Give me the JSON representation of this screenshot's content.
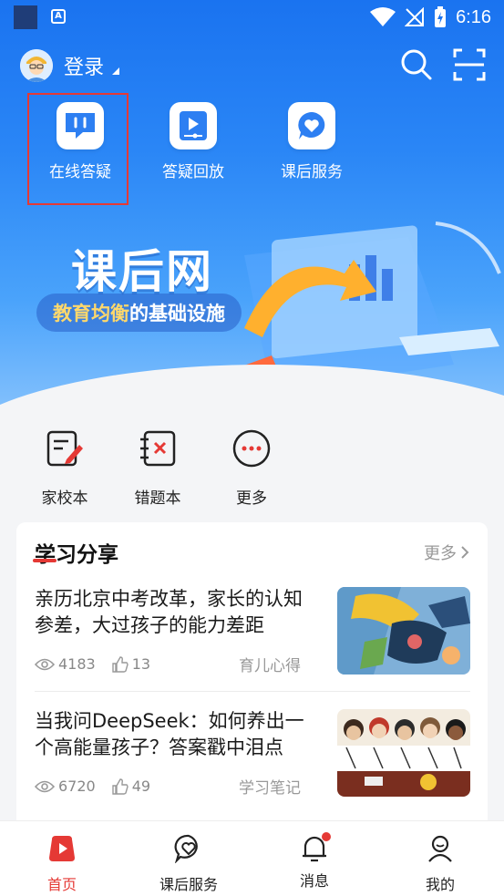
{
  "status_bar": {
    "time": "6:16"
  },
  "header": {
    "login_label": "登录"
  },
  "quick_actions": [
    {
      "label": "在线答疑",
      "icon": "chat-bubble-icon"
    },
    {
      "label": "答疑回放",
      "icon": "video-playback-icon"
    },
    {
      "label": "课后服务",
      "icon": "heart-bubble-icon"
    }
  ],
  "banner": {
    "title": "课后网",
    "subtitle_highlight": "教育均衡",
    "subtitle_rest": "的基础设施"
  },
  "tools": [
    {
      "label": "家校本",
      "icon": "notebook-edit-icon"
    },
    {
      "label": "错题本",
      "icon": "wrong-question-icon"
    },
    {
      "label": "更多",
      "icon": "more-dots-icon"
    }
  ],
  "study_share": {
    "title": "学习分享",
    "more_label": "更多",
    "articles": [
      {
        "title": "亲历北京中考改革，家长的认知参差，大过孩子的能力差距",
        "views": "4183",
        "likes": "13",
        "tag": "育儿心得"
      },
      {
        "title": "当我问DeepSeek：如何养出一个高能量孩子？答案戳中泪点",
        "views": "6720",
        "likes": "49",
        "tag": "学习笔记"
      }
    ]
  },
  "bottom_nav": [
    {
      "label": "首页",
      "active": true
    },
    {
      "label": "课后服务",
      "active": false
    },
    {
      "label": "消息",
      "active": false,
      "badge": true
    },
    {
      "label": "我的",
      "active": false
    }
  ],
  "colors": {
    "primary_blue": "#1a73f0",
    "accent_red": "#e53935"
  }
}
